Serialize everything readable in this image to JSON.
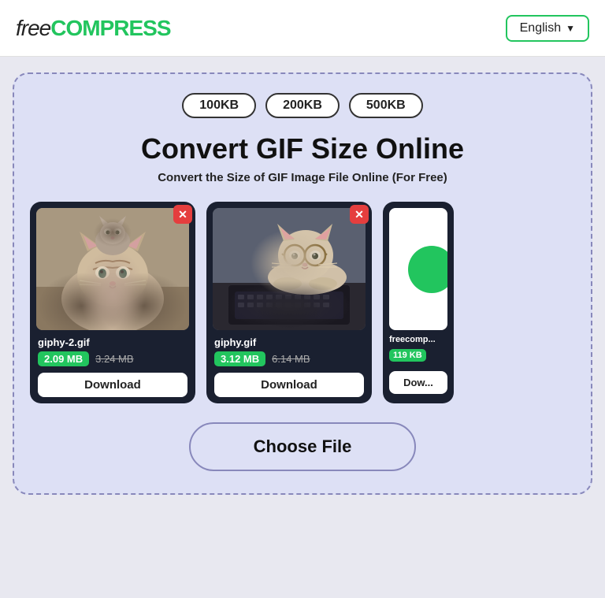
{
  "header": {
    "logo_free": "free",
    "logo_compress": "COMPRESS",
    "lang_label": "English",
    "lang_chevron": "▼"
  },
  "card": {
    "badges": [
      "100KB",
      "200KB",
      "500KB"
    ],
    "title": "Convert GIF Size Online",
    "subtitle": "Convert the Size of GIF Image File Online (For Free)",
    "files": [
      {
        "name": "giphy-2.gif",
        "size_new": "2.09 MB",
        "size_old": "3.24 MB",
        "download_label": "Download"
      },
      {
        "name": "giphy.gif",
        "size_new": "3.12 MB",
        "size_old": "6.14 MB",
        "download_label": "Download"
      },
      {
        "name": "freecomp...",
        "size_new": "119 KB",
        "size_old": "",
        "download_label": "Dow..."
      }
    ],
    "choose_file_label": "Choose File"
  }
}
